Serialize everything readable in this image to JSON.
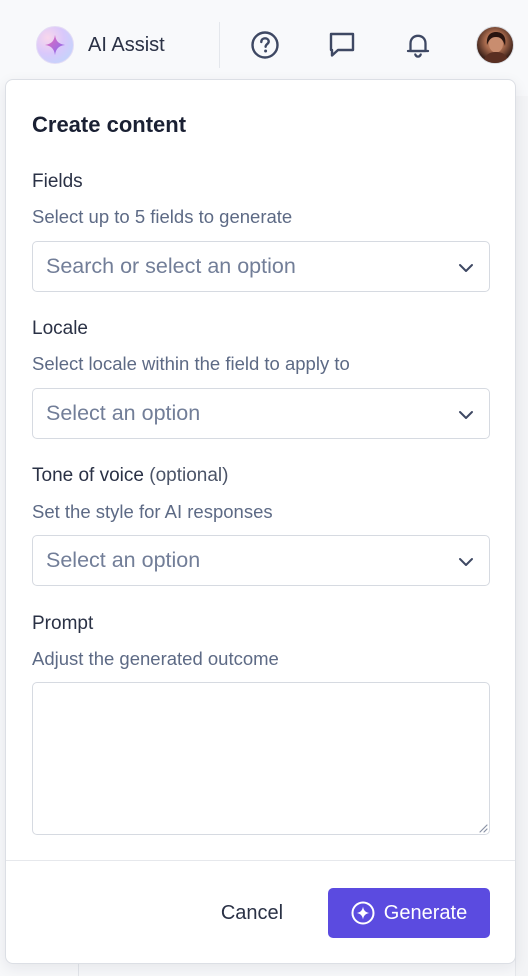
{
  "topbar": {
    "ai_assist_label": "AI Assist",
    "icons": [
      "help-icon",
      "chat-icon",
      "bell-icon"
    ]
  },
  "panel": {
    "title": "Create content",
    "fields": {
      "label": "Fields",
      "help": "Select up to 5 fields to generate",
      "placeholder": "Search or select an option"
    },
    "locale": {
      "label": "Locale",
      "help": "Select locale within the field to apply to",
      "placeholder": "Select an option"
    },
    "tone": {
      "label": "Tone of voice",
      "optional": "(optional)",
      "help": "Set the style for AI responses",
      "placeholder": "Select an option"
    },
    "prompt": {
      "label": "Prompt",
      "help": "Adjust the generated outcome",
      "value": ""
    },
    "footer": {
      "cancel_label": "Cancel",
      "generate_label": "Generate"
    }
  },
  "colors": {
    "accent": "#5b4be0",
    "text_primary": "#1a2033",
    "text_secondary": "#5d6a85",
    "border": "#d6dae1"
  }
}
